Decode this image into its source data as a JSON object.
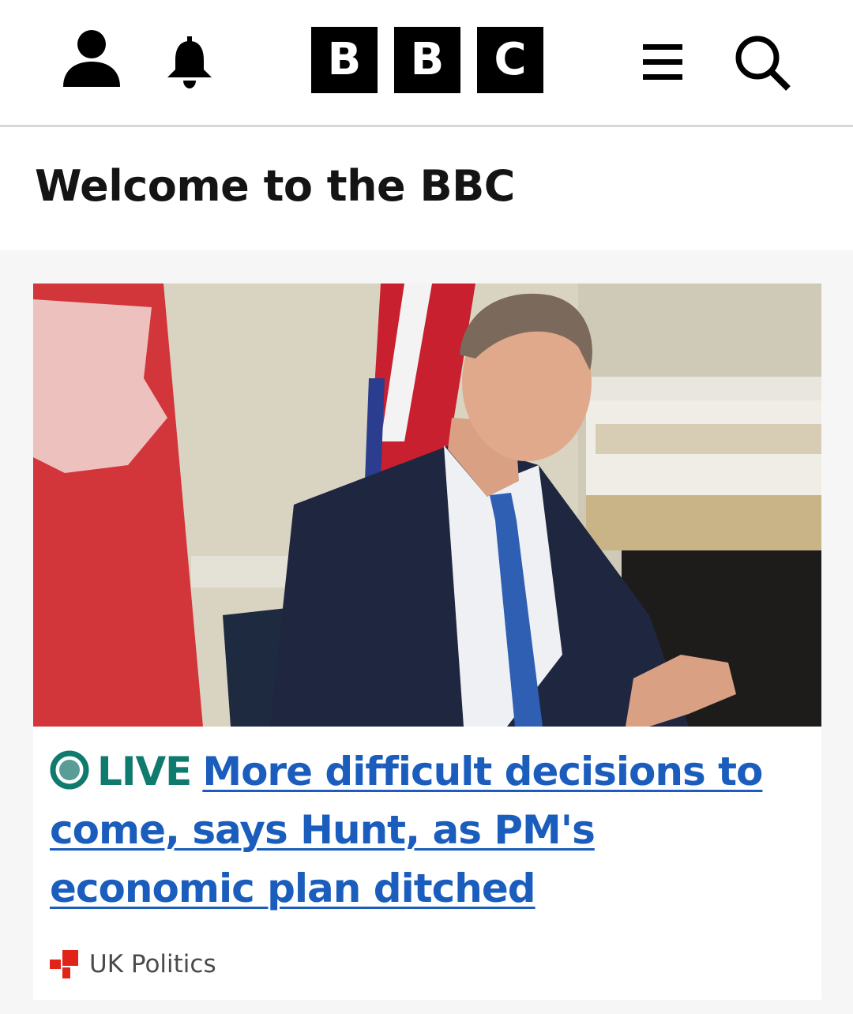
{
  "header": {
    "logo_letters": [
      "B",
      "B",
      "C"
    ],
    "icons": {
      "account": "account-icon",
      "notifications": "bell-icon",
      "menu": "hamburger-menu-icon",
      "search": "search-icon"
    }
  },
  "welcome": {
    "title": "Welcome to the BBC"
  },
  "story": {
    "live_label": "LIVE",
    "headline": "More difficult decisions to come, says Hunt, as PM's economic plan ditched",
    "topic": "UK Politics",
    "colors": {
      "live": "#0f7a6e",
      "link": "#1a5dbd",
      "topic_icon": "#e2231a"
    }
  }
}
